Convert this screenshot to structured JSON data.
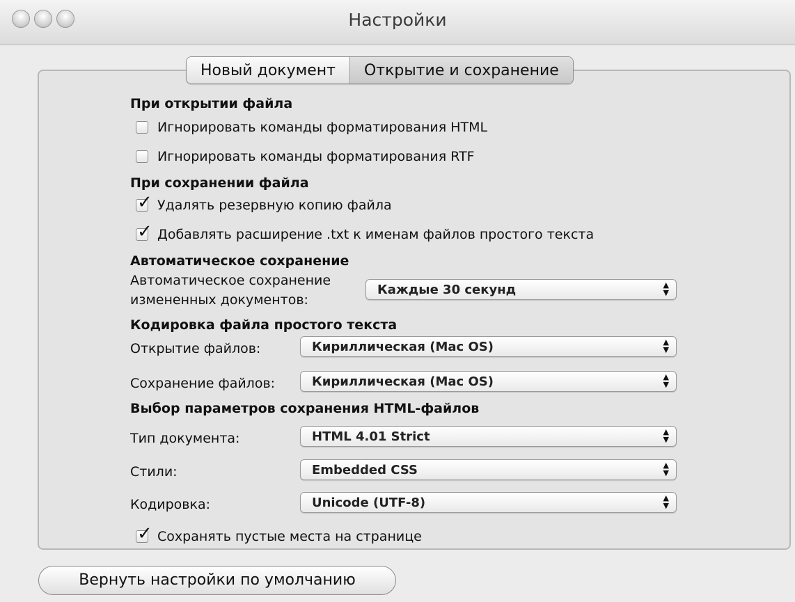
{
  "window": {
    "title": "Настройки"
  },
  "tabs": [
    {
      "label": "Новый документ"
    },
    {
      "label": "Открытие и сохранение"
    }
  ],
  "open_section": {
    "title": "При открытии файла",
    "ignore_html": {
      "label": "Игнорировать команды форматирования HTML",
      "checked": false
    },
    "ignore_rtf": {
      "label": "Игнорировать команды форматирования RTF",
      "checked": false
    }
  },
  "save_section": {
    "title": "При сохранении файла",
    "delete_backup": {
      "label": "Удалять резервную копию файла",
      "checked": true
    },
    "add_txt": {
      "label": "Добавлять расширение .txt к именам файлов простого текста",
      "checked": true
    }
  },
  "autosave_section": {
    "title": "Автоматическое сохранение",
    "label_line1": "Автоматическое сохранение",
    "label_line2": "измененных документов:",
    "value": "Каждые 30 секунд"
  },
  "encoding_section": {
    "title": "Кодировка файла простого текста",
    "open_label": "Открытие файлов:",
    "open_value": "Кириллическая (Mac OS)",
    "save_label": "Сохранение файлов:",
    "save_value": "Кириллическая (Mac OS)"
  },
  "html_section": {
    "title": "Выбор параметров сохранения HTML-файлов",
    "doctype_label": "Тип документа:",
    "doctype_value": "HTML 4.01 Strict",
    "styles_label": "Стили:",
    "styles_value": "Embedded CSS",
    "encoding_label": "Кодировка:",
    "encoding_value": "Unicode (UTF-8)",
    "preserve_whitespace": {
      "label": "Сохранять пустые места на странице",
      "checked": true
    }
  },
  "footer": {
    "reset_label": "Вернуть настройки по умолчанию"
  },
  "icons": {
    "check": "✓",
    "popup_arrows": "▲▼"
  }
}
